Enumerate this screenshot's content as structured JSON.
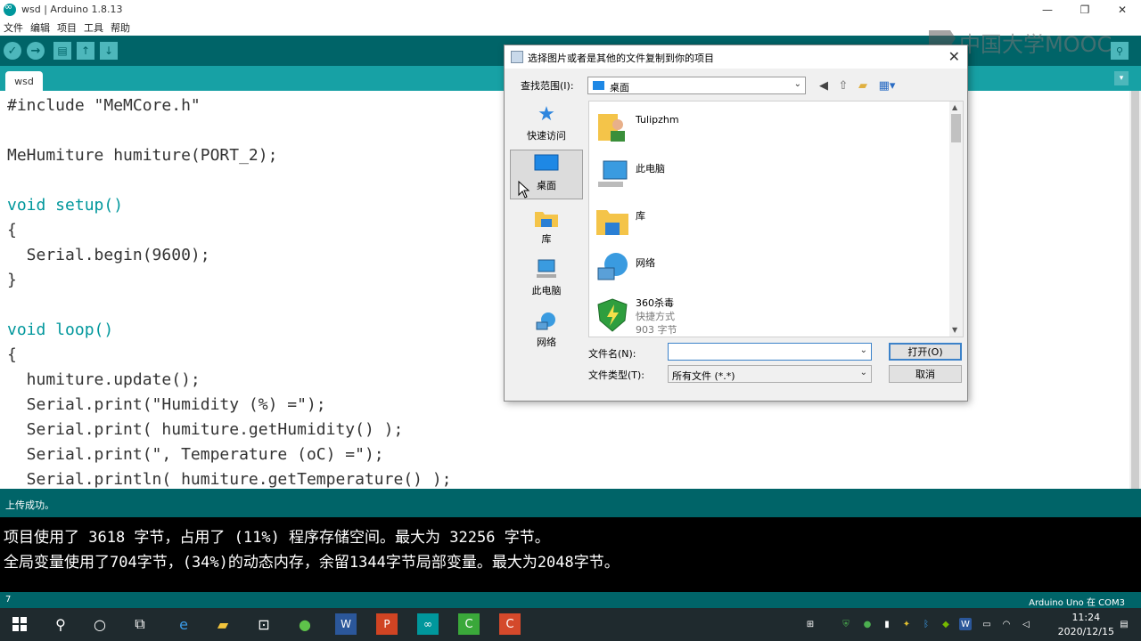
{
  "window": {
    "title": "wsd | Arduino 1.8.13",
    "minimize": "—",
    "restore": "❐",
    "close": "✕"
  },
  "menu": [
    "文件",
    "编辑",
    "项目",
    "工具",
    "帮助"
  ],
  "toolbar": {
    "verify": "✓",
    "upload": "→",
    "new": "▤",
    "open": "↑",
    "save": "↓",
    "serial_monitor": "⚲"
  },
  "tab": {
    "label": "wsd",
    "menu": "▾"
  },
  "code": [
    "#include \"MeMCore.h\"",
    "",
    "MeHumiture humiture(PORT_2);",
    "",
    "void setup()",
    "{",
    "  Serial.begin(9600);",
    "}",
    "",
    "void loop()",
    "{",
    "  humiture.update();",
    "  Serial.print(\"Humidity (%) =\");",
    "  Serial.print( humiture.getHumidity() );",
    "  Serial.print(\", Temperature (oC) =\");",
    "  Serial.println( humiture.getTemperature() );"
  ],
  "status": "上传成功。",
  "console": [
    "项目使用了 3618 字节，占用了 (11%) 程序存储空间。最大为 32256 字节。",
    "全局变量使用了704字节，(34%)的动态内存，余留1344字节局部变量。最大为2048字节。"
  ],
  "footer": {
    "line": "7",
    "board": "Arduino Uno 在 COM3"
  },
  "watermark": "中国大学MOOC",
  "dialog": {
    "title": "选择图片或者是其他的文件复制到你的项目",
    "close": "✕",
    "look_in_label": "查找范围(I):",
    "look_in_value": "桌面",
    "places": [
      "快速访问",
      "桌面",
      "库",
      "此电脑",
      "网络"
    ],
    "files": [
      {
        "name": "Tulipzhm",
        "icon": "user-folder-icon"
      },
      {
        "name": "此电脑",
        "icon": "computer-icon"
      },
      {
        "name": "库",
        "icon": "library-folder-icon"
      },
      {
        "name": "网络",
        "icon": "network-icon"
      },
      {
        "name": "360杀毒",
        "sub1": "快捷方式",
        "sub2": "903 字节",
        "icon": "shield-icon"
      }
    ],
    "filename_label": "文件名(N):",
    "filename_value": "",
    "filetype_label": "文件类型(T):",
    "filetype_value": "所有文件 (*.*)",
    "open_button": "打开(O)",
    "cancel_button": "取消"
  },
  "taskbar": {
    "time": "11:24",
    "date": "2020/12/15"
  },
  "colors": {
    "arduino_dark": "#006468",
    "arduino_mid": "#17a1a5",
    "keyword": "#00979c",
    "function": "#d35400"
  }
}
